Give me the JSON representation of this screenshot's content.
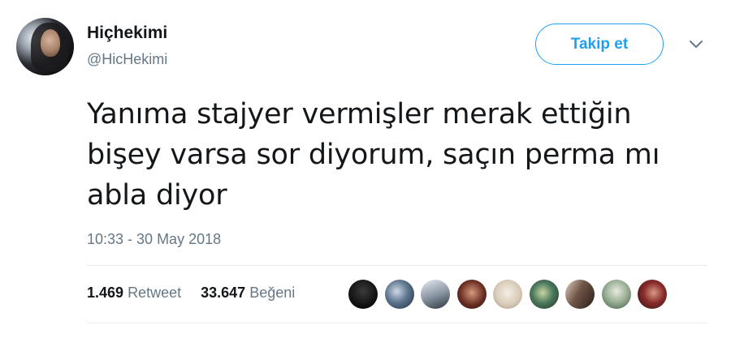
{
  "user": {
    "display_name": "Hiçhekimi",
    "handle": "@HicHekimi"
  },
  "actions": {
    "follow_label": "Takip et",
    "more_icon": "chevron-down-icon"
  },
  "tweet": {
    "text_lines": [
      "Yanıma stajyer vermişler merak ettiğin",
      "bişey varsa sor diyorum, saçın perma mı",
      "abla diyor"
    ],
    "timestamp": "10:33 - 30 May 2018"
  },
  "stats": {
    "retweet_count": "1.469",
    "retweet_label": "Retweet",
    "like_count": "33.647",
    "like_label": "Beğeni"
  },
  "colors": {
    "accent": "#1da1f2",
    "secondary_text": "#657786",
    "primary_text": "#14171a",
    "divider": "#e6ecf0"
  },
  "likers": [
    {
      "name": "liker-avatar-1",
      "bg": "radial-gradient(circle at 50% 40%, #3a3a3a 0%, #0c0c0c 70%)"
    },
    {
      "name": "liker-avatar-2",
      "bg": "radial-gradient(circle at 40% 40%, #cfd8e3 0%, #5e7690 45%, #1d2b3a 100%)"
    },
    {
      "name": "liker-avatar-3",
      "bg": "linear-gradient(160deg, #e7ecf1 0%, #8d99a6 50%, #2c3440 100%)"
    },
    {
      "name": "liker-avatar-4",
      "bg": "radial-gradient(circle at 50% 45%, #d69a7c 0%, #6b2f24 55%, #1c0d0a 100%)"
    },
    {
      "name": "liker-avatar-5",
      "bg": "radial-gradient(circle at 50% 45%, #f5efe6 0%, #d9cbb8 55%, #9f8f7a 100%)"
    },
    {
      "name": "liker-avatar-6",
      "bg": "radial-gradient(circle at 45% 45%, #c8d6a2 0%, #4d7a5d 45%, #1d2d25 100%)"
    },
    {
      "name": "liker-avatar-7",
      "bg": "linear-gradient(120deg, #e3d1c3 0%, #6e5447 45%, #2a1d17 100%)"
    },
    {
      "name": "liker-avatar-8",
      "bg": "radial-gradient(circle at 50% 40%, #e8eadf 0%, #9fb49a 45%, #3f5a44 100%)"
    },
    {
      "name": "liker-avatar-9",
      "bg": "radial-gradient(circle at 55% 45%, #d99a86 0%, #8a2b2b 45%, #2b0f0f 100%)"
    }
  ]
}
